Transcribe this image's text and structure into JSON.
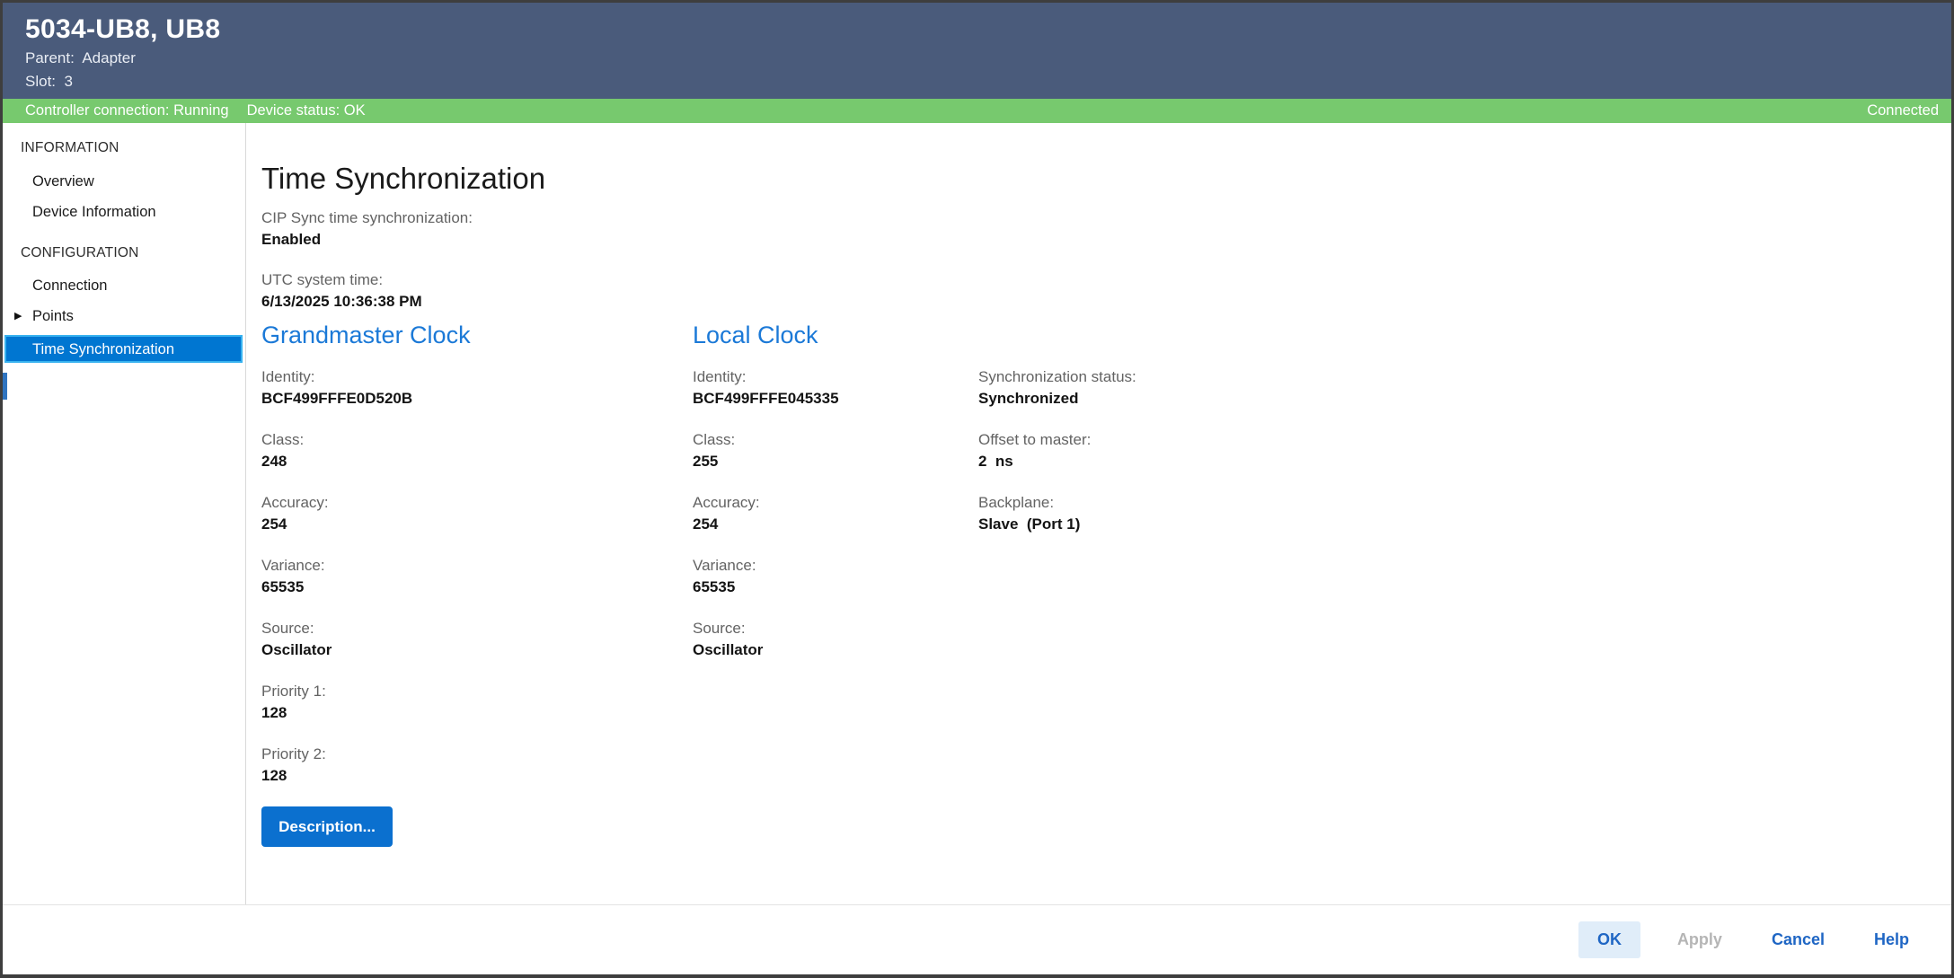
{
  "header": {
    "title": "5034-UB8, UB8",
    "parent_line": "Parent:  Adapter",
    "slot_line": "Slot:  3"
  },
  "status_bar": {
    "controller_connection": "Controller connection: Running",
    "device_status": "Device status: OK",
    "connection_state": "Connected"
  },
  "sidebar": {
    "sections": [
      {
        "title": "INFORMATION"
      },
      {
        "title": "CONFIGURATION"
      }
    ],
    "items": [
      {
        "label": "Overview"
      },
      {
        "label": "Device Information"
      },
      {
        "label": "Connection"
      },
      {
        "label": "Points",
        "expander": "▶"
      },
      {
        "label": "Time Synchronization",
        "selected": true
      }
    ]
  },
  "main": {
    "title": "Time Synchronization",
    "top_fields": [
      {
        "label": "CIP Sync time synchronization:",
        "value": "Enabled"
      },
      {
        "label": "UTC system time:",
        "value": "6/13/2025 10:36:38 PM"
      }
    ],
    "grandmaster": {
      "heading": "Grandmaster Clock",
      "fields": [
        {
          "label": "Identity:",
          "value": "BCF499FFFE0D520B"
        },
        {
          "label": "Class:",
          "value": "248"
        },
        {
          "label": "Accuracy:",
          "value": "254"
        },
        {
          "label": "Variance:",
          "value": "65535"
        },
        {
          "label": "Source:",
          "value": "Oscillator"
        },
        {
          "label": "Priority 1:",
          "value": "128"
        },
        {
          "label": "Priority 2:",
          "value": "128"
        }
      ],
      "description_button": "Description..."
    },
    "local": {
      "heading": "Local Clock",
      "fields": [
        {
          "label": "Identity:",
          "value": "BCF499FFFE045335"
        },
        {
          "label": "Class:",
          "value": "255"
        },
        {
          "label": "Accuracy:",
          "value": "254"
        },
        {
          "label": "Variance:",
          "value": "65535"
        },
        {
          "label": "Source:",
          "value": "Oscillator"
        }
      ]
    },
    "sync_status": {
      "fields": [
        {
          "label": "Synchronization status:",
          "value": "Synchronized"
        },
        {
          "label": "Offset to master:",
          "value": "2  ns"
        },
        {
          "label": "Backplane:",
          "value": "Slave  (Port 1)"
        }
      ]
    }
  },
  "footer": {
    "ok": "OK",
    "apply": "Apply",
    "cancel": "Cancel",
    "help": "Help"
  },
  "colors": {
    "header_bg": "#4a5b7b",
    "status_bar_bg": "#77c96e",
    "selected_item_bg": "#0076d1",
    "selected_item_border": "#38b2ef",
    "section_heading_blue": "#1b79d7",
    "primary_button_bg": "#0b70cf",
    "footer_link_blue": "#1f66c4",
    "ok_button_bg": "#e0edf9",
    "disabled_text": "#b5b5b5",
    "label_gray": "#636363"
  }
}
